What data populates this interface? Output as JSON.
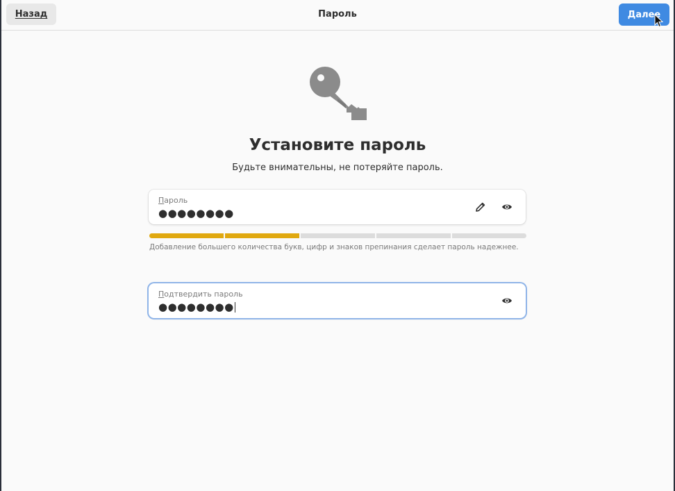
{
  "header": {
    "back_label": "Назад",
    "title": "Пароль",
    "next_label": "Далее"
  },
  "main": {
    "icon": "key-icon",
    "heading": "Установите пароль",
    "subheading": "Будьте внимательны, не потеряйте пароль."
  },
  "password_field": {
    "label_accel": "П",
    "label_rest": "ароль",
    "value": "●●●●●●●●",
    "icons": [
      "pencil-icon",
      "eye-icon"
    ]
  },
  "strength": {
    "level": 2,
    "max": 5,
    "color": "#e0a80f",
    "hint": "Добавление большего количества букв, цифр и знаков препинания сделает пароль надежнее."
  },
  "confirm_field": {
    "label_accel": "П",
    "label_rest": "одтвердить пароль",
    "value": "●●●●●●●●",
    "icons": [
      "eye-icon"
    ]
  },
  "colors": {
    "accent": "#3f8ae2",
    "background": "#fafafa",
    "focus_ring": "#8fb4e8"
  }
}
